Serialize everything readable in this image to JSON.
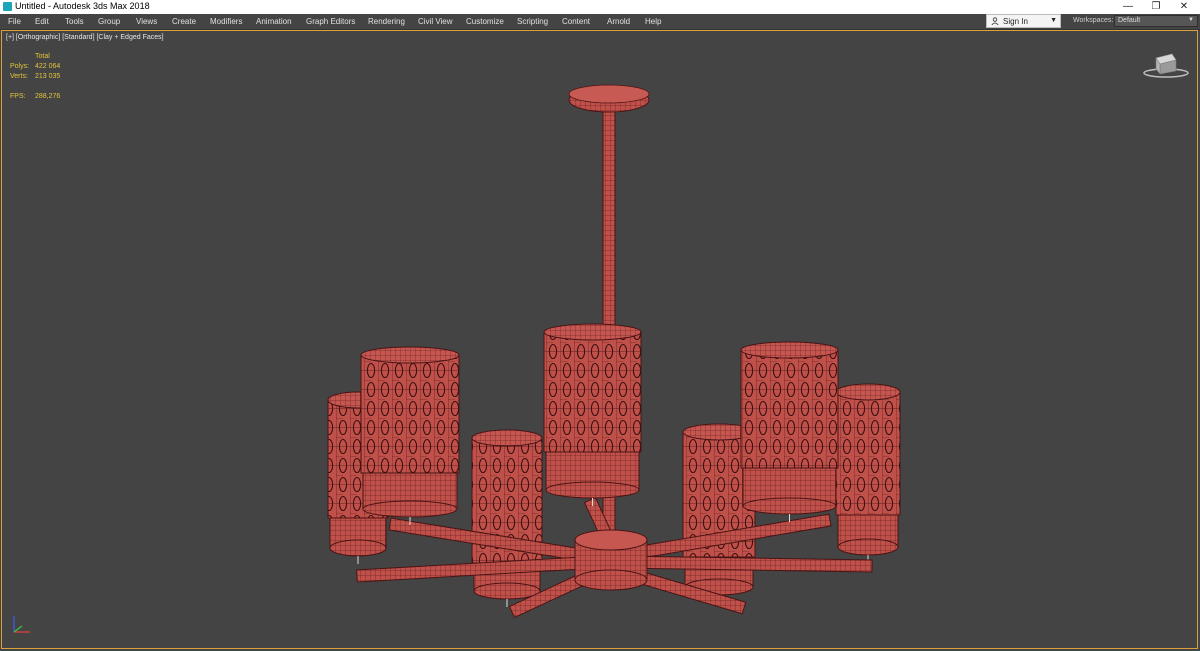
{
  "window": {
    "title": "Untitled - Autodesk 3ds Max 2018",
    "minimize": "—",
    "restore": "❐",
    "close": "✕"
  },
  "menu": [
    "File",
    "Edit",
    "Tools",
    "Group",
    "Views",
    "Create",
    "Modifiers",
    "Animation",
    "Graph Editors",
    "Rendering",
    "Civil View",
    "Customize",
    "Scripting",
    "Content",
    "Arnold",
    "Help"
  ],
  "signin": {
    "label": "Sign In",
    "icon": "user-icon"
  },
  "workspace": {
    "label": "Workspaces:",
    "value": "Default"
  },
  "viewport": {
    "label": "[+] [Orthographic] [Standard] [Clay + Edged Faces]",
    "stats": {
      "header": "Total",
      "polys_label": "Polys:",
      "polys_value": "422 064",
      "verts_label": "Verts:",
      "verts_value": "213 035",
      "fps_label": "FPS:",
      "fps_value": "288,276"
    }
  },
  "colors": {
    "model": "#c0504a",
    "wire": "#4a1414",
    "viewport_bg": "#444444",
    "stats": "#e3c53a",
    "active_border": "#d9a23c"
  }
}
